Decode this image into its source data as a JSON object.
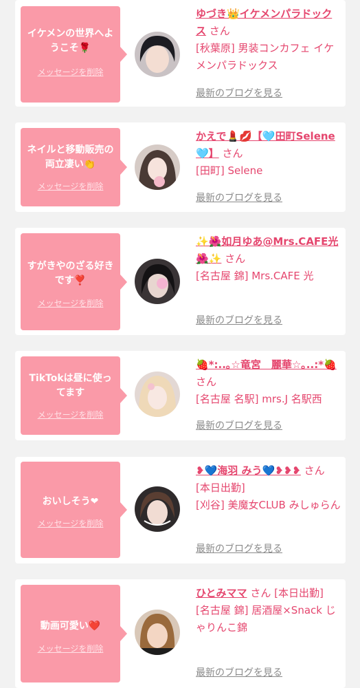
{
  "san_suffix": "さん",
  "delete_label": "メッセージを削除",
  "blog_label": "最新のブログを見る",
  "colors": {
    "accent": "#e5466e",
    "bubble": "#fa9aa8",
    "link_gray": "#8a8a8a",
    "background": "#f2f2f2"
  },
  "items": [
    {
      "message": "イケメンの世界へようこそ🌹",
      "name": "ゆづき👑イケメンパラドックス",
      "shop": "[秋葉原] 男装コンカフェ イケメンパラドックス"
    },
    {
      "message": "ネイルと移動販売の両立凄い👏",
      "name": "かえで💄💋【🩵田町Selene🩵】",
      "shop": "[田町] Selene"
    },
    {
      "message": "すがきやのざる好きです❣️",
      "name": "✨🌺如月ゆあ@Mrs.CAFE光🌺✨",
      "shop": "[名古屋 錦] Mrs.CAFE 光"
    },
    {
      "message": "TikTokは昼に使ってます",
      "name": "🍓*:..｡☆竜宮　麗華☆｡..:*🍓",
      "shop": "[名古屋 名駅] mrs.J 名駅西"
    },
    {
      "message": "おいしそう❤︎",
      "name": "❥💙海羽 みう💙❥❥❥",
      "shop": "[本日出勤]\n[刈谷] 美魔女CLUB みしゅらん"
    },
    {
      "message": "動画可愛い❤️",
      "name": "ひとみママ",
      "shop": "[本日出勤]\n[名古屋 錦] 居酒屋×Snack じゃりんこ錦"
    }
  ]
}
